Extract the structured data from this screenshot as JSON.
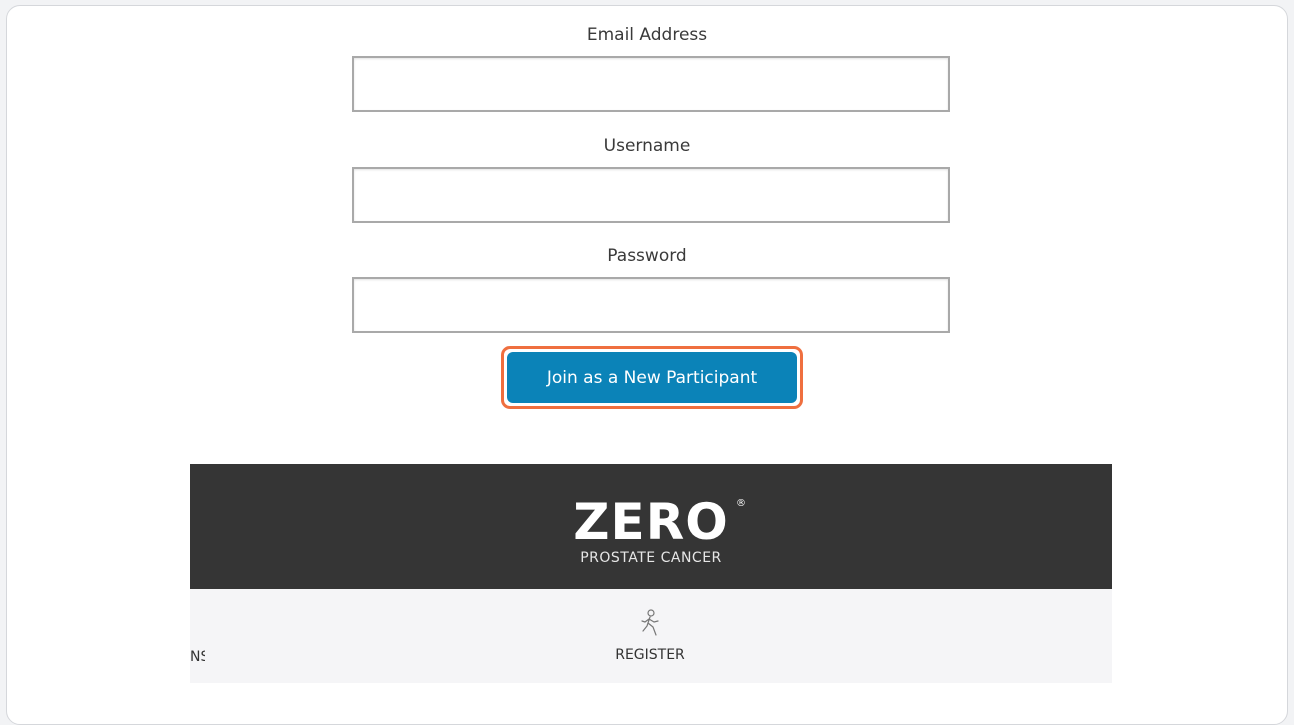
{
  "form": {
    "email_label": "Email Address",
    "email_value": "",
    "username_label": "Username",
    "username_value": "",
    "password_label": "Password",
    "password_value": "",
    "submit_label": "Join as a New Participant"
  },
  "footer": {
    "logo_main": "ZERO",
    "logo_registered": "®",
    "logo_sub": "PROSTATE CANCER"
  },
  "nav": {
    "left_partial": "NS",
    "register_label": "REGISTER",
    "register_icon": "walking-person-icon"
  },
  "colors": {
    "button": "#0b83b8",
    "highlight_border": "#ef6f3f",
    "footer_band": "#353535",
    "nav_band": "#f5f5f7"
  }
}
